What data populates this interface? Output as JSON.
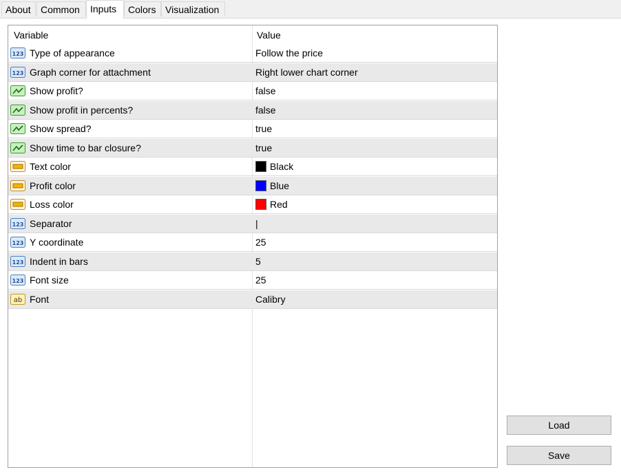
{
  "tabs": [
    {
      "label": "About"
    },
    {
      "label": "Common"
    },
    {
      "label": "Inputs"
    },
    {
      "label": "Colors"
    },
    {
      "label": "Visualization"
    }
  ],
  "table": {
    "col_variable": "Variable",
    "col_value": "Value",
    "rows": [
      {
        "icon": "numeric-icon",
        "label": "Type of appearance",
        "value": "Follow the price"
      },
      {
        "icon": "numeric-icon",
        "label": "Graph corner for attachment",
        "value": "Right lower chart corner"
      },
      {
        "icon": "boolean-icon",
        "label": "Show profit?",
        "value": "false"
      },
      {
        "icon": "boolean-icon",
        "label": "Show profit in percents?",
        "value": "false"
      },
      {
        "icon": "boolean-icon",
        "label": "Show spread?",
        "value": "true"
      },
      {
        "icon": "boolean-icon",
        "label": "Show time to bar closure?",
        "value": "true"
      },
      {
        "icon": "color-icon",
        "label": "Text color",
        "value": "Black",
        "color": "#000000"
      },
      {
        "icon": "color-icon",
        "label": "Profit color",
        "value": "Blue",
        "color": "#0000ff"
      },
      {
        "icon": "color-icon",
        "label": "Loss color",
        "value": "Red",
        "color": "#ff0000"
      },
      {
        "icon": "numeric-icon",
        "label": "Separator",
        "value": "|"
      },
      {
        "icon": "numeric-icon",
        "label": "Y coordinate",
        "value": "25"
      },
      {
        "icon": "numeric-icon",
        "label": "Indent in bars",
        "value": "5"
      },
      {
        "icon": "numeric-icon",
        "label": "Font size",
        "value": "25"
      },
      {
        "icon": "string-icon",
        "label": "Font",
        "value": "Calibry"
      }
    ]
  },
  "buttons": {
    "load": "Load",
    "save": "Save"
  },
  "icon_text": {
    "numeric": "123",
    "string": "ab"
  }
}
